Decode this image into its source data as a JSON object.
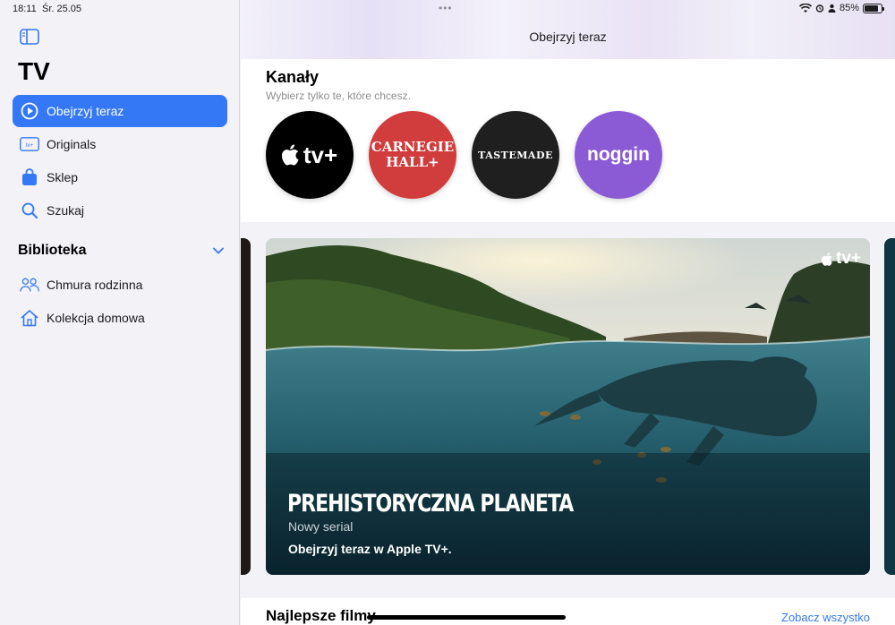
{
  "status_bar": {
    "time": "18:11",
    "date": "Śr. 25.05",
    "battery": "85%",
    "battery_level": 0.85
  },
  "sidebar": {
    "app_title": "TV",
    "nav": [
      {
        "label": "Obejrzyj teraz",
        "icon": "play-circle-icon",
        "active": true
      },
      {
        "label": "Originals",
        "icon": "appletv-icon"
      },
      {
        "label": "Sklep",
        "icon": "bag-icon"
      },
      {
        "label": "Szukaj",
        "icon": "search-icon"
      }
    ],
    "library": {
      "title": "Biblioteka",
      "items": [
        {
          "label": "Chmura rodzinna",
          "icon": "people-icon"
        },
        {
          "label": "Kolekcja domowa",
          "icon": "house-icon"
        }
      ]
    }
  },
  "main": {
    "nav_title": "Obejrzyj teraz",
    "channels": {
      "title": "Kanały",
      "subtitle": "Wybierz tylko te, które chcesz.",
      "items": [
        {
          "name": "tv+",
          "logo": "appletv-logo"
        },
        {
          "name": "CARNEGIE HALL+",
          "line1": "CARNEGIE",
          "line2": "HALL+"
        },
        {
          "name": "TASTEMADE"
        },
        {
          "name": "noggin"
        }
      ]
    },
    "hero": {
      "brand": "tv+",
      "title": "PREHISTORYCZNA PLANETA",
      "subtitle": "Nowy serial",
      "cta": "Obejrzyj teraz w Apple TV+."
    },
    "bottom_section": {
      "title": "Najlepsze filmy",
      "see_all": "Zobacz wszystko"
    }
  },
  "colors": {
    "accent": "#3478f6",
    "carnegie": "#d13c3c",
    "noggin": "#8b5bd6"
  }
}
